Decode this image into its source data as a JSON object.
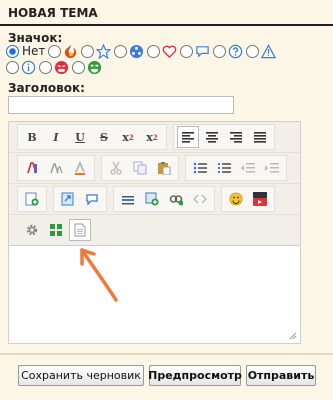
{
  "header": {
    "title": "НОВАЯ ТЕМА"
  },
  "icon_section": {
    "label": "Значок:",
    "none_label": "Нет",
    "options": [
      {
        "icon": "none"
      },
      {
        "icon": "fire-icon",
        "color": "#e34a1a"
      },
      {
        "icon": "star-icon",
        "color": "#3a7bd5"
      },
      {
        "icon": "film-reel-icon",
        "color": "#3a7bd5"
      },
      {
        "icon": "heart-icon",
        "color": "#e0303a"
      },
      {
        "icon": "speech-bubble-icon",
        "color": "#3a7bd5"
      },
      {
        "icon": "question-icon",
        "color": "#3a7bd5"
      },
      {
        "icon": "warning-icon",
        "color": "#3a7bd5"
      },
      {
        "icon": "info-icon",
        "color": "#3a7bd5"
      },
      {
        "icon": "angry-face-icon",
        "color": "#e0303a"
      },
      {
        "icon": "happy-face-icon",
        "color": "#2f9a3a"
      }
    ]
  },
  "title_section": {
    "label": "Заголовок:",
    "value": ""
  },
  "toolbar": {
    "bold": "B",
    "italic": "I",
    "underline": "U",
    "strike": "S",
    "subscript": "x",
    "sub_mark": "2",
    "superscript": "x",
    "sup_mark": "2"
  },
  "editor": {
    "content": ""
  },
  "buttons": {
    "save_draft": "Сохранить черновик",
    "preview": "Предпросмотр",
    "submit": "Отправить"
  }
}
